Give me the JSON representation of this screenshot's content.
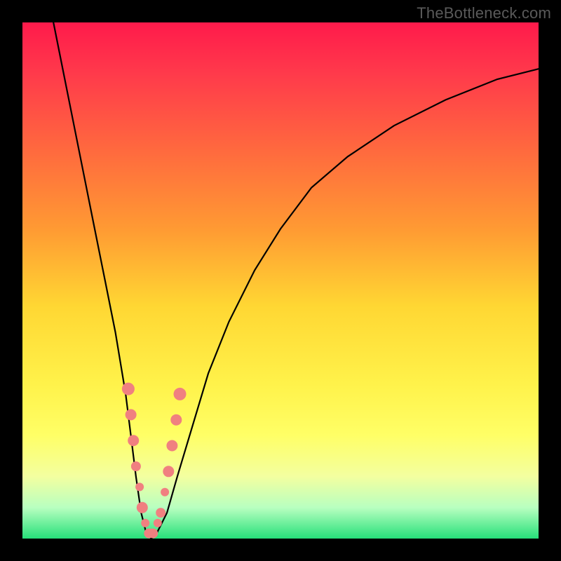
{
  "watermark": "TheBottleneck.com",
  "chart_data": {
    "type": "line",
    "title": "",
    "xlabel": "",
    "ylabel": "",
    "xlim": [
      0,
      100
    ],
    "ylim": [
      0,
      100
    ],
    "grid": false,
    "series": [
      {
        "name": "bottleneck-curve",
        "x": [
          6,
          8,
          10,
          12,
          14,
          16,
          18,
          20,
          21,
          22,
          23,
          24,
          25,
          26,
          28,
          30,
          33,
          36,
          40,
          45,
          50,
          56,
          63,
          72,
          82,
          92,
          100
        ],
        "y": [
          100,
          90,
          80,
          70,
          60,
          50,
          40,
          28,
          20,
          12,
          5,
          1,
          0,
          1,
          5,
          12,
          22,
          32,
          42,
          52,
          60,
          68,
          74,
          80,
          85,
          89,
          91
        ]
      }
    ],
    "markers": [
      {
        "x": 20.5,
        "y": 29,
        "r": 9
      },
      {
        "x": 21.0,
        "y": 24,
        "r": 8
      },
      {
        "x": 21.5,
        "y": 19,
        "r": 8
      },
      {
        "x": 22.0,
        "y": 14,
        "r": 7
      },
      {
        "x": 22.7,
        "y": 10,
        "r": 6
      },
      {
        "x": 23.2,
        "y": 6,
        "r": 8
      },
      {
        "x": 23.8,
        "y": 3,
        "r": 6
      },
      {
        "x": 24.5,
        "y": 1,
        "r": 7
      },
      {
        "x": 25.3,
        "y": 1,
        "r": 7
      },
      {
        "x": 26.2,
        "y": 3,
        "r": 6
      },
      {
        "x": 26.8,
        "y": 5,
        "r": 7
      },
      {
        "x": 27.6,
        "y": 9,
        "r": 6
      },
      {
        "x": 28.3,
        "y": 13,
        "r": 8
      },
      {
        "x": 29.0,
        "y": 18,
        "r": 8
      },
      {
        "x": 29.8,
        "y": 23,
        "r": 8
      },
      {
        "x": 30.5,
        "y": 28,
        "r": 9
      }
    ],
    "marker_color": "#f08080",
    "curve_color": "#000000"
  }
}
